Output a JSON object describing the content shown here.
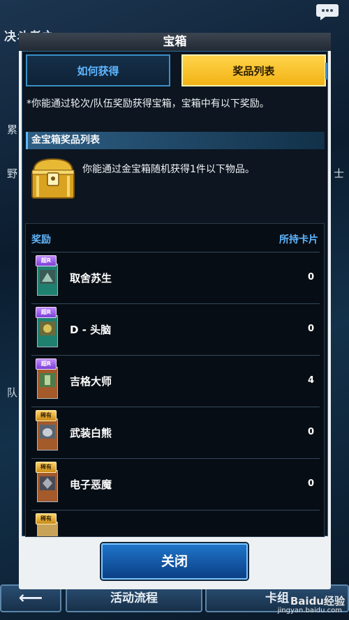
{
  "background": {
    "screen_title": "决斗者之",
    "side_text_1": "累",
    "side_text_2": "野",
    "side_text_3": "队",
    "right_text": "士",
    "bottom_buttons": {
      "back_arrow": "⟵",
      "flow": "活动流程",
      "deck": "卡组"
    }
  },
  "watermark": {
    "brand": "Baidu经验",
    "url": "jingyan.baidu.com"
  },
  "dialog": {
    "title": "宝箱",
    "tabs": [
      {
        "label": "如何获得",
        "active": false
      },
      {
        "label": "奖品列表",
        "active": true
      }
    ],
    "description": "*你能通过轮次/队伍奖励获得宝箱，宝箱中有以下奖励。",
    "section_title": "金宝箱奖品列表",
    "chest_description": "你能通过金宝箱随机获得1件以下物品。",
    "list_headers": {
      "reward": "奖励",
      "owned": "所持卡片"
    },
    "items": [
      {
        "rarity": "超R",
        "name": "取舍苏生",
        "owned": "0"
      },
      {
        "rarity": "超R",
        "name": "D - 头脑",
        "owned": "0"
      },
      {
        "rarity": "超R",
        "name": "吉格大师",
        "owned": "4"
      },
      {
        "rarity": "稀有",
        "name": "武装白熊",
        "owned": "0"
      },
      {
        "rarity": "稀有",
        "name": "电子恶魔",
        "owned": "0"
      },
      {
        "rarity": "稀有",
        "name": "",
        "owned": ""
      }
    ],
    "close_label": "关闭"
  },
  "colors": {
    "accent_blue": "#5fb6ff",
    "active_tab": "#ffd34a",
    "dialog_bg": "#0c1520"
  }
}
